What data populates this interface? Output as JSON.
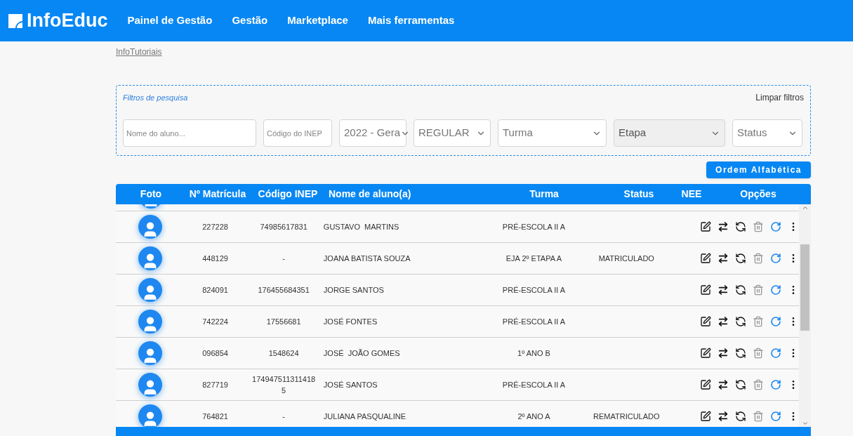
{
  "header": {
    "logo": "InfoEduc",
    "nav": [
      "Painel de Gestão",
      "Gestão",
      "Marketplace",
      "Mais ferramentas"
    ]
  },
  "breadcrumb_link": "InfoTutoriais",
  "filters": {
    "title": "Filtros de pesquisa",
    "clear": "Limpar filtros",
    "fields": [
      {
        "kind": "input",
        "placeholder": "Nome do aluno...",
        "disabled": false
      },
      {
        "kind": "input",
        "placeholder": "Código do INEP",
        "disabled": false
      },
      {
        "kind": "select",
        "value": "2022 - Gera",
        "disabled": false
      },
      {
        "kind": "select",
        "value": "REGULAR",
        "disabled": false
      },
      {
        "kind": "select",
        "value": "Turma",
        "disabled": false
      },
      {
        "kind": "select",
        "value": "Etapa",
        "disabled": true
      },
      {
        "kind": "select",
        "value": "Status",
        "disabled": false
      }
    ]
  },
  "sort_button": "Ordem Alfabética",
  "table": {
    "columns": [
      "Foto",
      "Nº Matrícula",
      "Código INEP",
      "Nome de aluno(a)",
      "Turma",
      "Status",
      "NEE",
      "Opções"
    ],
    "rows": [
      {
        "matricula": "227228",
        "inep": "74985617831",
        "nome": "GUSTAVO  MARTINS",
        "turma": "PRÉ-ESCOLA II A",
        "status": ""
      },
      {
        "matricula": "448129",
        "inep": "-",
        "nome": "JOANA BATISTA SOUZA",
        "turma": "EJA 2º ETAPA A",
        "status": "MATRICULADO"
      },
      {
        "matricula": "824091",
        "inep": "176455684351",
        "nome": "JORGE SANTOS",
        "turma": "PRÉ-ESCOLA II A",
        "status": ""
      },
      {
        "matricula": "742224",
        "inep": "17556681",
        "nome": "JOSÉ FONTES",
        "turma": "PRÉ-ESCOLA II A",
        "status": ""
      },
      {
        "matricula": "096854",
        "inep": "1548624",
        "nome": "JOSÉ  JOÃO GOMES",
        "turma": "1º ANO B",
        "status": ""
      },
      {
        "matricula": "827719",
        "inep": "1749475113114185",
        "nome": "JOSÉ SANTOS",
        "turma": "PRÉ-ESCOLA II A",
        "status": ""
      },
      {
        "matricula": "764821",
        "inep": "-",
        "nome": "JULIANA PASQUALINE",
        "turma": "2º ANO A",
        "status": "REMATRICULADO"
      }
    ]
  }
}
